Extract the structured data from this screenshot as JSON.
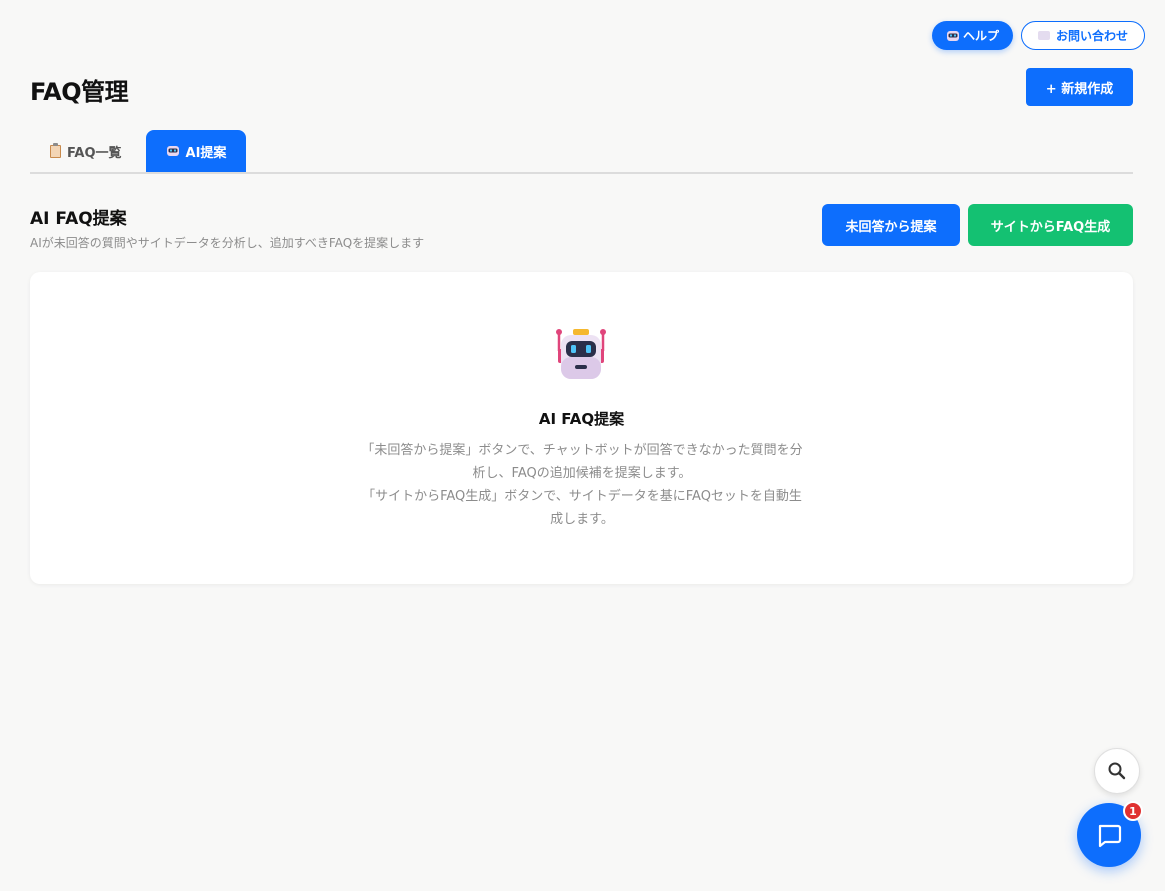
{
  "header": {
    "help_label": "ヘルプ",
    "contact_label": "お問い合わせ",
    "title": "FAQ管理",
    "new_label": "+ 新規作成"
  },
  "tabs": [
    {
      "label": "FAQ一覧",
      "icon": "clipboard-icon",
      "active": false
    },
    {
      "label": "AI提案",
      "icon": "robot-icon",
      "active": true
    }
  ],
  "section": {
    "title": "AI FAQ提案",
    "description": "AIが未回答の質問やサイトデータを分析し、追加すべきFAQを提案します",
    "unanswered_label": "未回答から提案",
    "site_label": "サイトからFAQ生成"
  },
  "empty_state": {
    "icon": "robot-icon",
    "title": "AI FAQ提案",
    "lines": [
      "「未回答から提案」ボタンで、チャットボットが回答できなかった質問を分",
      "析し、FAQの追加候補を提案します。",
      "「サイトからFAQ生成」ボタンで、サイトデータを基にFAQセットを自動生",
      "成します。"
    ]
  },
  "chat_widget": {
    "badge_count": "1"
  },
  "colors": {
    "primary": "#0d6efd",
    "success": "#14c172",
    "badge": "#e03131"
  }
}
